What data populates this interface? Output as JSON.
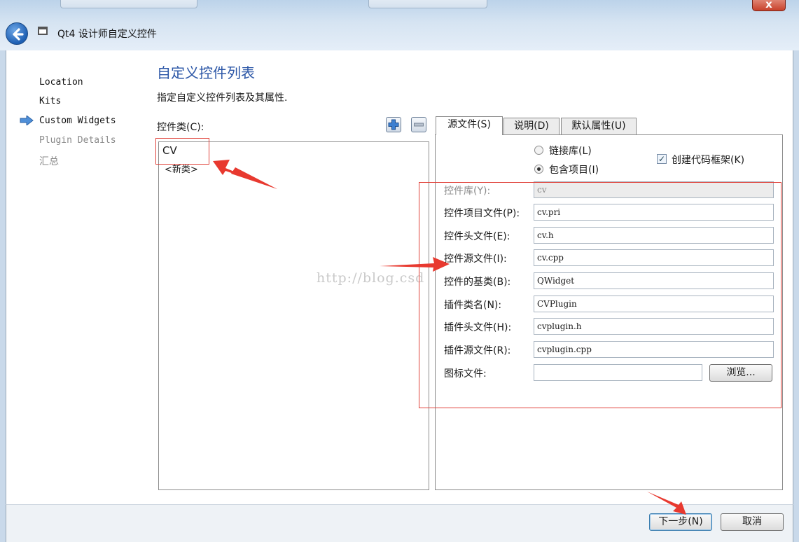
{
  "window": {
    "title": "Qt4 设计师自定义控件",
    "close_glyph": "x"
  },
  "sidebar": {
    "items": [
      {
        "label": "Location",
        "state": "done"
      },
      {
        "label": "Kits",
        "state": "done"
      },
      {
        "label": "Custom Widgets",
        "state": "current"
      },
      {
        "label": "Plugin Details",
        "state": "pending"
      },
      {
        "label": "汇总",
        "state": "pending"
      }
    ],
    "current_marker_icon": "arrow-right-icon"
  },
  "main": {
    "title": "自定义控件列表",
    "subtitle": "指定自定义控件列表及其属性."
  },
  "class_list": {
    "label": "控件类(C):",
    "add_icon": "plus-icon",
    "remove_icon": "minus-icon",
    "items": [
      "CV",
      "<新类>"
    ]
  },
  "tabs": [
    {
      "label": "源文件(S)",
      "active": true
    },
    {
      "label": "说明(D)",
      "active": false
    },
    {
      "label": "默认属性(U)",
      "active": false
    }
  ],
  "source": {
    "link_library_label": "链接库(L)",
    "include_project_label": "包含项目(I)",
    "selected": "include_project",
    "create_skeleton_label": "创建代码框架(K)",
    "create_skeleton_checked": true,
    "fields": [
      {
        "label": "控件库(Y):",
        "value": "cv",
        "readonly": true
      },
      {
        "label": "控件项目文件(P):",
        "value": "cv.pri"
      },
      {
        "label": "控件头文件(E):",
        "value": "cv.h"
      },
      {
        "label": "控件源文件(I):",
        "value": "cv.cpp"
      },
      {
        "label": "控件的基类(B):",
        "value": "QWidget"
      },
      {
        "label": "插件类名(N):",
        "value": "CVPlugin"
      },
      {
        "label": "插件头文件(H):",
        "value": "cvplugin.h"
      },
      {
        "label": "插件源文件(R):",
        "value": "cvplugin.cpp"
      },
      {
        "label": "图标文件:",
        "value": ""
      }
    ],
    "browse_label": "浏览..."
  },
  "buttons": {
    "next": "下一步(N)",
    "cancel": "取消"
  },
  "watermark": "http://blog.csd",
  "colors": {
    "accent_title": "#2a55a6",
    "annotation_red": "#e0423a"
  }
}
